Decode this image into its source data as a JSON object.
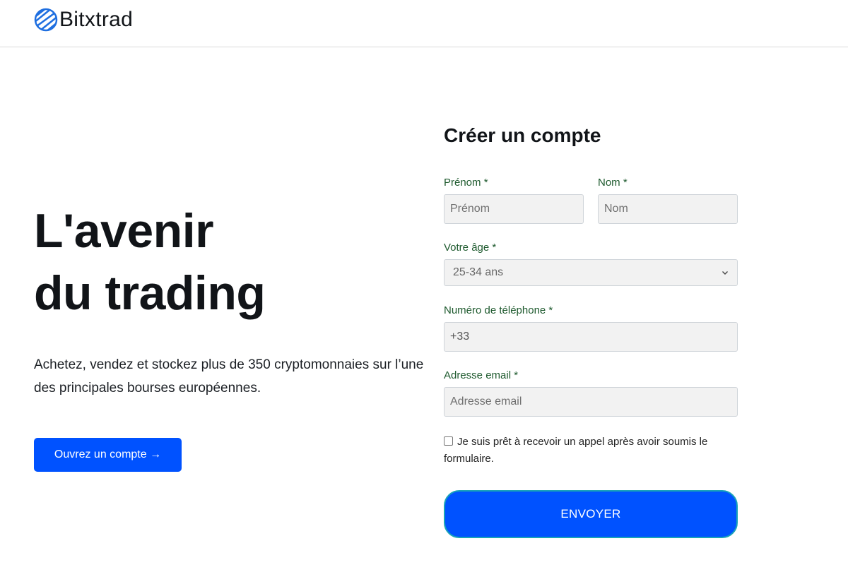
{
  "brand": {
    "name": "Bitxtrad",
    "icon": "globe-stripes-icon",
    "accent": "#0052ff"
  },
  "hero": {
    "title_line1": "L'avenir",
    "title_line2": "du trading",
    "description": "Achetez, vendez et stockez plus de 350 cryptomonnaies sur l’une des principales bourses européennes.",
    "cta_label": "Ouvrez un compte →"
  },
  "form": {
    "title": "Créer un compte",
    "first_name": {
      "label": "Prénom *",
      "placeholder": "Prénom",
      "value": ""
    },
    "last_name": {
      "label": "Nom *",
      "placeholder": "Nom",
      "value": ""
    },
    "age": {
      "label": "Votre âge *",
      "selected": "25-34 ans"
    },
    "phone": {
      "label": "Numéro de téléphone *",
      "value": "+33"
    },
    "email": {
      "label": "Adresse email *",
      "placeholder": "Adresse email",
      "value": ""
    },
    "consent": {
      "label": "Je suis prêt à recevoir un appel après avoir soumis le formulaire.",
      "checked": false
    },
    "submit_label": "ENVOYER"
  },
  "colors": {
    "label_green": "#1e5a2e",
    "submit_border": "#19a3b8"
  }
}
